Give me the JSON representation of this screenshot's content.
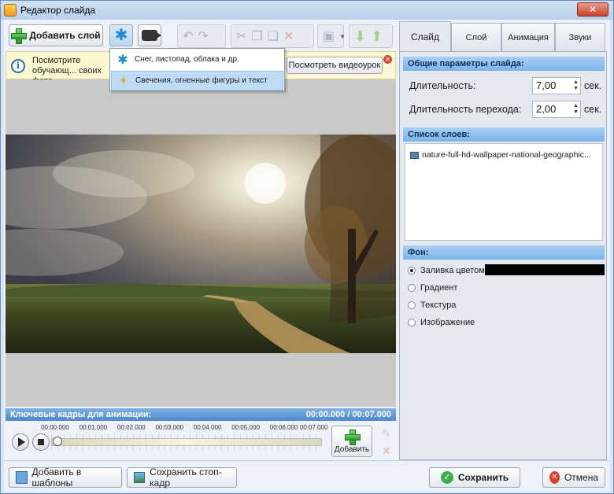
{
  "window": {
    "title": "Редактор слайда",
    "close_label": "✕"
  },
  "toolbar": {
    "add_layer_label": "Добавить слой"
  },
  "effects_menu": {
    "items": [
      {
        "label": "Снег, листопад, облака и др.",
        "icon": "snowflake-icon"
      },
      {
        "label": "Свечения, огненные фигуры и текст",
        "icon": "sparkle-icon"
      }
    ]
  },
  "info_bar": {
    "text": "Посмотрите обучающ... своих фото...",
    "watch_video_label": "Посмотреть видеоурок"
  },
  "keyframes": {
    "title": "Ключевые кадры для анимации:",
    "time": "00:00.000 / 00:07.000",
    "ticks": [
      "00:00.000",
      "00:01.000",
      "00:02.000",
      "00:03.000",
      "00:04.000",
      "00:05.000",
      "00:06.000",
      "00:07.000"
    ],
    "add_label": "Добавить"
  },
  "tabs": [
    {
      "label": "Слайд",
      "active": true
    },
    {
      "label": "Слой",
      "active": false
    },
    {
      "label": "Анимация",
      "active": false
    },
    {
      "label": "Звуки",
      "active": false
    }
  ],
  "slide_params": {
    "header": "Общие параметры слайда:",
    "duration_label": "Длительность:",
    "duration_value": "7,00",
    "transition_label": "Длительность перехода:",
    "transition_value": "2,00",
    "unit": "сек."
  },
  "layers": {
    "header": "Список слоев:",
    "items": [
      "nature-full-hd-wallpaper-national-geographic..."
    ]
  },
  "background": {
    "header": "Фон:",
    "options": [
      {
        "label": "Заливка цветом",
        "checked": true
      },
      {
        "label": "Градиент",
        "checked": false
      },
      {
        "label": "Текстура",
        "checked": false
      },
      {
        "label": "Изображение",
        "checked": false
      }
    ],
    "fill_color": "#000000"
  },
  "bottom": {
    "add_template_label": "Добавить в шаблоны",
    "save_still_label": "Сохранить стоп-кадр",
    "save_label": "Сохранить",
    "cancel_label": "Отмена"
  }
}
